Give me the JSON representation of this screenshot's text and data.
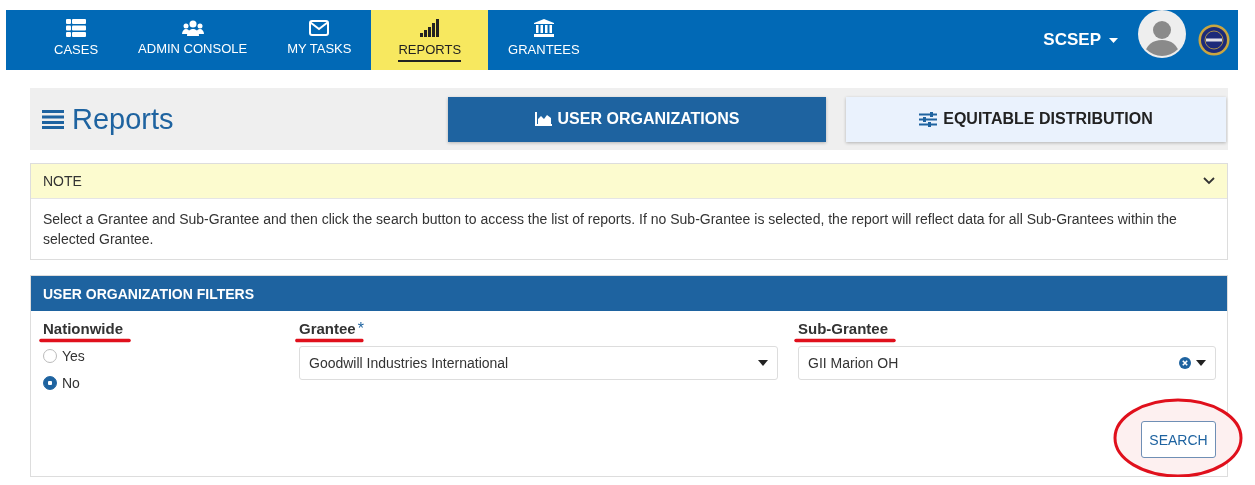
{
  "nav": {
    "items": [
      {
        "label": "CASES",
        "selected": false
      },
      {
        "label": "ADMIN CONSOLE",
        "selected": false
      },
      {
        "label": "MY TASKS",
        "selected": false
      },
      {
        "label": "REPORTS",
        "selected": true
      },
      {
        "label": "GRANTEES",
        "selected": false
      }
    ],
    "user": {
      "label": "SCSEP"
    }
  },
  "header": {
    "title": "Reports",
    "tabs": [
      {
        "label": "USER ORGANIZATIONS",
        "selected": true
      },
      {
        "label": "EQUITABLE DISTRIBUTION",
        "selected": false
      }
    ]
  },
  "note": {
    "title": "NOTE",
    "expanded": true,
    "text": "Select a Grantee and Sub-Grantee and then click the search button to access the list of reports. If no Sub-Grantee is selected, the report will reflect data for all Sub-Grantees within the selected Grantee."
  },
  "filters": {
    "title": "USER ORGANIZATION FILTERS",
    "nationwide": {
      "label": "Nationwide",
      "underlined": true,
      "options": [
        {
          "label": "Yes",
          "selected": false
        },
        {
          "label": "No",
          "selected": true
        }
      ]
    },
    "grantee": {
      "label": "Grantee",
      "required_mark": "*",
      "underlined": true,
      "value": "Goodwill Industries International",
      "clearable": false
    },
    "sub_grantee": {
      "label": "Sub-Grantee",
      "underlined": true,
      "value": "GII Marion OH",
      "clearable": true
    },
    "search_button": {
      "label": "SEARCH",
      "circled": true
    }
  }
}
